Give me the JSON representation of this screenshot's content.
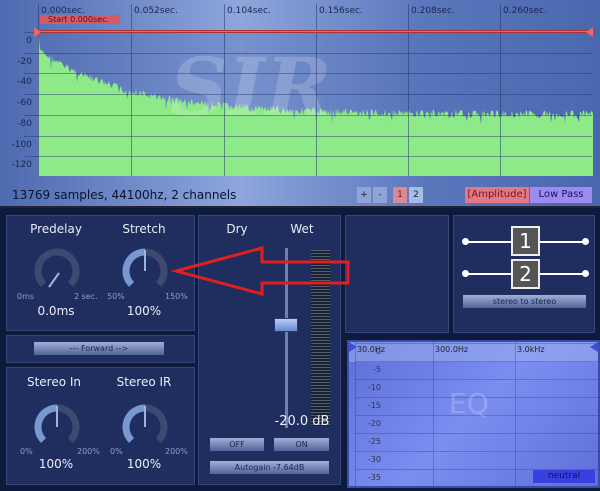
{
  "waveform": {
    "time_labels": [
      "0.000sec.",
      "0.052sec.",
      "0.104sec.",
      "0.156sec.",
      "0.208sec.",
      "0.260sec."
    ],
    "db_labels": [
      "0",
      "-20",
      "-40",
      "-60",
      "-80",
      "-100",
      "-120"
    ],
    "start_label": "Start 0.000sec.",
    "watermark": "SIR",
    "info": "13769 samples, 44100hz, 2 channels",
    "zoom_in": "+",
    "zoom_out": "-",
    "channel_1": "1",
    "channel_2": "2",
    "amplitude_button": "[Amplitude]",
    "lowpass_button": "Low Pass",
    "fill_color": "#8eea88"
  },
  "predelay": {
    "label": "Predelay",
    "min": "0ms",
    "max": "2 sec.",
    "value": "0.0ms",
    "fraction": 0
  },
  "stretch": {
    "label": "Stretch",
    "min": "50%",
    "max": "150%",
    "value": "100%",
    "fraction": 0.5
  },
  "forward_button": "--- Forward -->",
  "stereo_in": {
    "label": "Stereo In",
    "min": "0%",
    "max": "200%",
    "value": "100%",
    "fraction": 0.5
  },
  "stereo_ir": {
    "label": "Stereo IR",
    "min": "0%",
    "max": "200%",
    "value": "100%",
    "fraction": 0.5
  },
  "mix": {
    "dry_label": "Dry",
    "wet_label": "Wet",
    "value": "-20.0 dB",
    "off_button": "OFF",
    "on_button": "ON",
    "autogain_button": "Autogain -7.64dB"
  },
  "routing": {
    "channel_1": "1",
    "channel_2": "2",
    "mode_button": "stereo to stereo"
  },
  "eq": {
    "freq_labels": [
      "30.0Hz",
      "300.0Hz",
      "3.0kHz"
    ],
    "db_labels": [
      "0",
      "-5",
      "-10",
      "-15",
      "-20",
      "-25",
      "-30",
      "-35"
    ],
    "watermark": "EQ",
    "neutral_button": "neutral"
  }
}
